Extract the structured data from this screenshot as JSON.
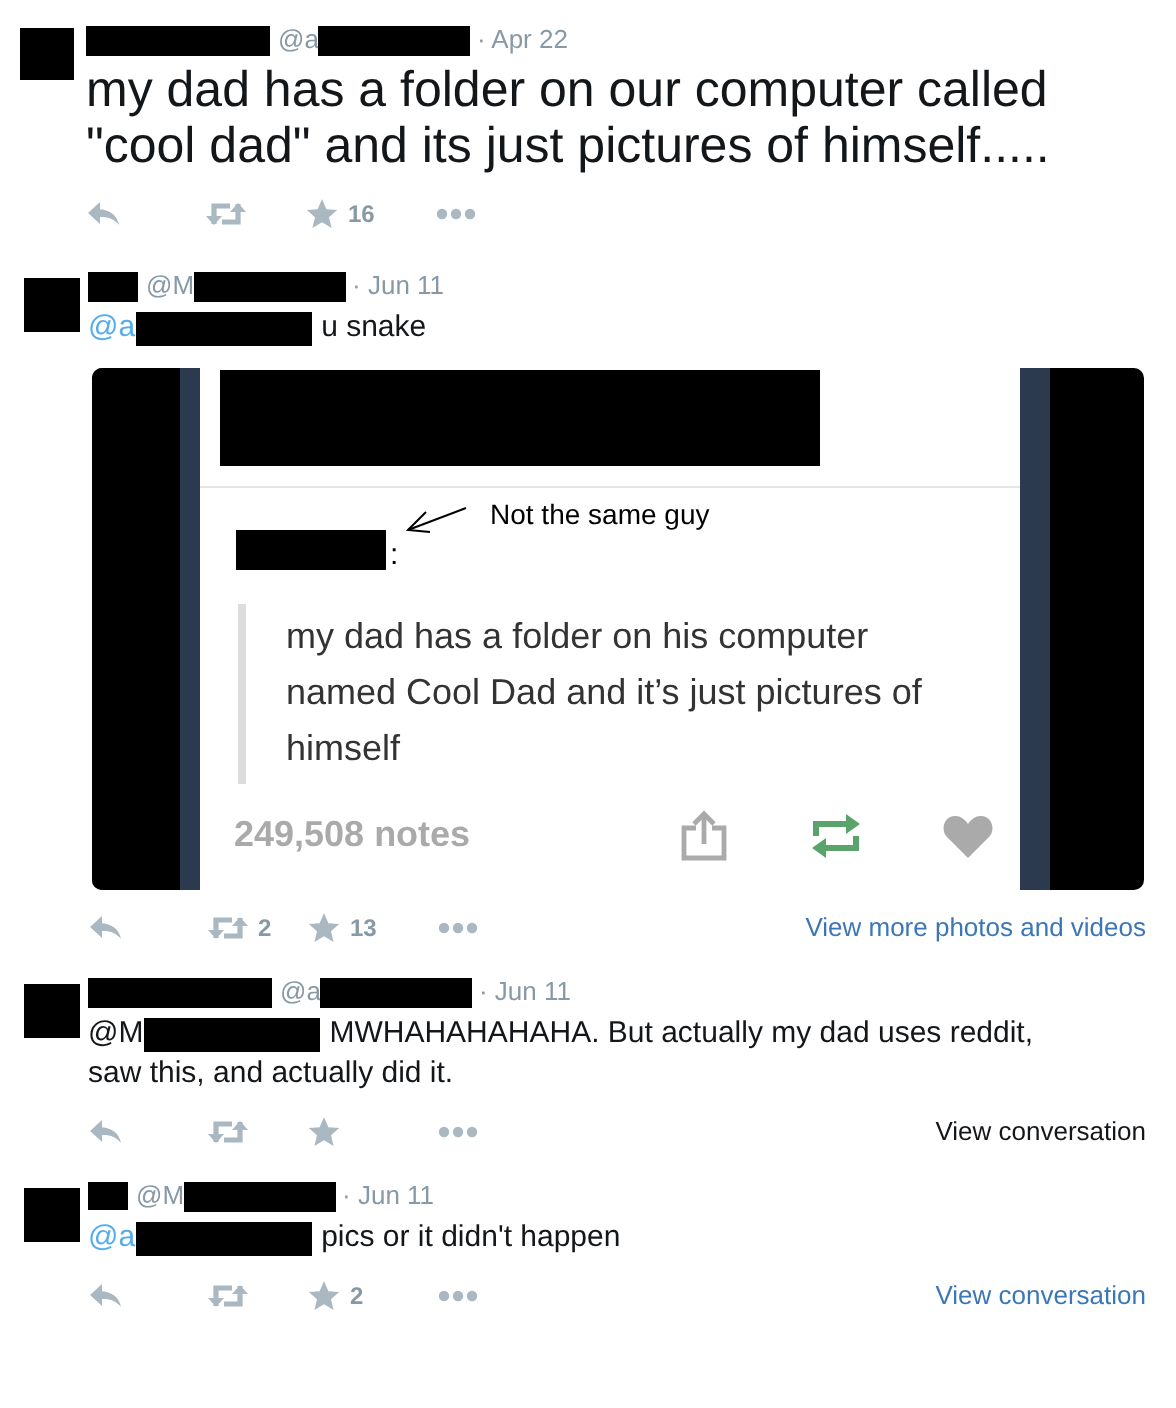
{
  "tweets": [
    {
      "kind": "large",
      "handle": "@a",
      "date": "· Apr 22",
      "text": "my dad has a folder on our computer called \"cool dad\" and its just pictures of himself.....",
      "actions": {
        "favorites": "16"
      }
    },
    {
      "kind": "reply",
      "handle": "@M",
      "date": "· Jun 11",
      "mention": {
        "text": "@a",
        "linked": true
      },
      "text": "u snake",
      "media": {
        "annotation": "Not the same guy",
        "colon": ":",
        "quote": "my dad has a folder on his computer named Cool Dad and it’s just pictures of himself",
        "notes": "249,508 notes",
        "reblogged": true
      },
      "actions": {
        "retweets": "2",
        "favorites": "13"
      },
      "link": {
        "text": "View more photos and videos",
        "hovered": false
      }
    },
    {
      "kind": "reply",
      "handle": "@a",
      "date": "· Jun 11",
      "mention": {
        "text": "@M",
        "linked": false
      },
      "text": "MWHAHAHAHAHA. But actually my dad uses reddit, saw this, and actually did it.",
      "link": {
        "text": "View conversation",
        "hovered": true
      }
    },
    {
      "kind": "reply",
      "handle": "@M",
      "date": "· Jun 11",
      "mention": {
        "text": "@a",
        "linked": true
      },
      "text": "pics or it didn't happen",
      "actions": {
        "favorites": "2"
      },
      "link": {
        "text": "View conversation",
        "hovered": false
      }
    }
  ]
}
